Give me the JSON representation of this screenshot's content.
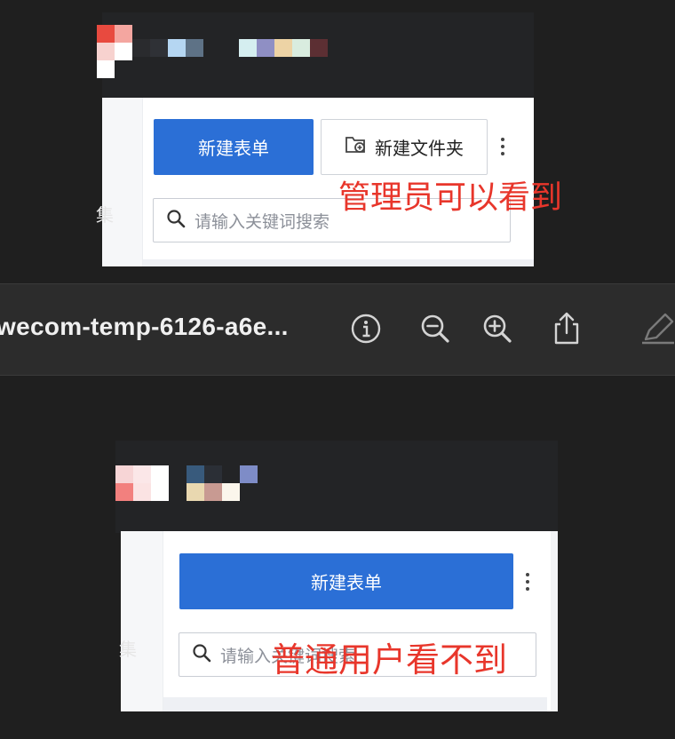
{
  "admin_view": {
    "new_form_button": "新建表单",
    "new_folder_button": "新建文件夹",
    "search_placeholder": "请输入关键词搜索",
    "annotation": "管理员可以看到",
    "side_char": "集"
  },
  "preview_toolbar": {
    "document_title": "wecom-temp-6126-a6e...",
    "buttons": {
      "info": "info-icon",
      "zoom_out": "zoom-out-icon",
      "zoom_in": "zoom-in-icon",
      "share": "share-icon",
      "markup": "pencil-icon"
    }
  },
  "user_view": {
    "new_form_button": "新建表单",
    "search_placeholder": "请输入关键词搜索",
    "annotation": "普通用户看不到",
    "side_char": "集"
  },
  "colors": {
    "primary_button": "#2b6fd6",
    "annotation_red": "#e8362b",
    "toolbar_bg": "#2c2c2c",
    "page_bg": "#1f1f1f"
  }
}
